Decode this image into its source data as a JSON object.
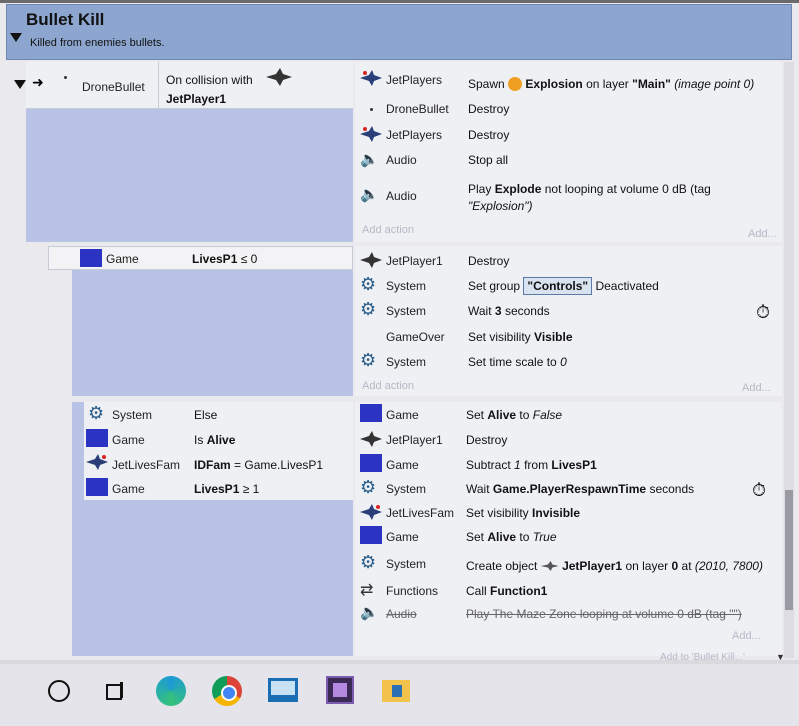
{
  "group": {
    "title": "Bullet Kill",
    "description": "Killed from enemies bullets."
  },
  "event1": {
    "object": "DroneBullet",
    "condition": [
      "On collision with",
      "JetPlayer1"
    ],
    "actions": [
      {
        "object": "JetPlayers",
        "icon": "jet-icon",
        "pre": "Spawn",
        "obj": "Explosion",
        "mid": "on layer",
        "layer": "\"Main\"",
        "post": "(image point 0)"
      },
      {
        "object": "DroneBullet",
        "icon": "dot-icon",
        "text": "Destroy"
      },
      {
        "object": "JetPlayers",
        "icon": "jet-icon",
        "text": "Destroy"
      },
      {
        "object": "Audio",
        "icon": "speaker-icon",
        "text": "Stop all"
      },
      {
        "object": "Audio",
        "icon": "speaker-icon",
        "pre": "Play",
        "name": "Explode",
        "post": "not looping at volume 0 dB (tag",
        "tag": "\"Explosion\")"
      }
    ],
    "add_action": "Add action",
    "add_more": "Add..."
  },
  "event2": {
    "object": "Game",
    "condition": "LivesP1 ≤ 0",
    "condition_bold": "LivesP1",
    "condition_rest": "≤ 0",
    "actions": [
      {
        "object": "JetPlayer1",
        "text": "Destroy"
      },
      {
        "object": "System",
        "pre": "Set group",
        "group": "\"Controls\"",
        "post": "Deactivated"
      },
      {
        "object": "System",
        "pre": "Wait",
        "value": "3",
        "post": "seconds"
      },
      {
        "object": "GameOver",
        "pre": "Set visibility",
        "value": "Visible"
      },
      {
        "object": "System",
        "pre": "Set time scale to",
        "value": "0"
      }
    ],
    "add_action": "Add action",
    "add_more": "Add..."
  },
  "event3": {
    "conditions": [
      {
        "object": "System",
        "text": "Else"
      },
      {
        "object": "Game",
        "pre": "Is",
        "bold": "Alive"
      },
      {
        "object": "JetLivesFam",
        "bold": "IDFam",
        "rest": "= Game.LivesP1"
      },
      {
        "object": "Game",
        "bold": "LivesP1",
        "rest": "≥ 1"
      }
    ],
    "actions": [
      {
        "object": "Game",
        "pre": "Set",
        "bold": "Alive",
        "mid": "to",
        "ital": "False"
      },
      {
        "object": "JetPlayer1",
        "text": "Destroy"
      },
      {
        "object": "Game",
        "pre": "Subtract",
        "ital": "1",
        "mid": "from",
        "bold": "LivesP1"
      },
      {
        "object": "System",
        "pre": "Wait",
        "bold": "Game.PlayerRespawnTime",
        "post": "seconds"
      },
      {
        "object": "JetLivesFam",
        "pre": "Set visibility",
        "bold": "Invisible"
      },
      {
        "object": "Game",
        "pre": "Set",
        "bold": "Alive",
        "mid": "to",
        "ital": "True"
      },
      {
        "object": "System",
        "pre": "Create object",
        "bold": "JetPlayer1",
        "mid": "on layer",
        "bold2": "0",
        "mid2": "at",
        "ital": "(2010, 7800)"
      },
      {
        "object": "Functions",
        "pre": "Call",
        "bold": "Function1"
      },
      {
        "object": "Audio",
        "text": "Play The Maze Zone looping at volume 0 dB (tag \"\")"
      }
    ],
    "add_more": "Add...",
    "add_to": "Add to 'Bullet Kill...'"
  },
  "colors": {
    "condition_bg": "#b8c3e6",
    "group_bg": "#8da6cf",
    "game_square": "#2b34c2"
  }
}
